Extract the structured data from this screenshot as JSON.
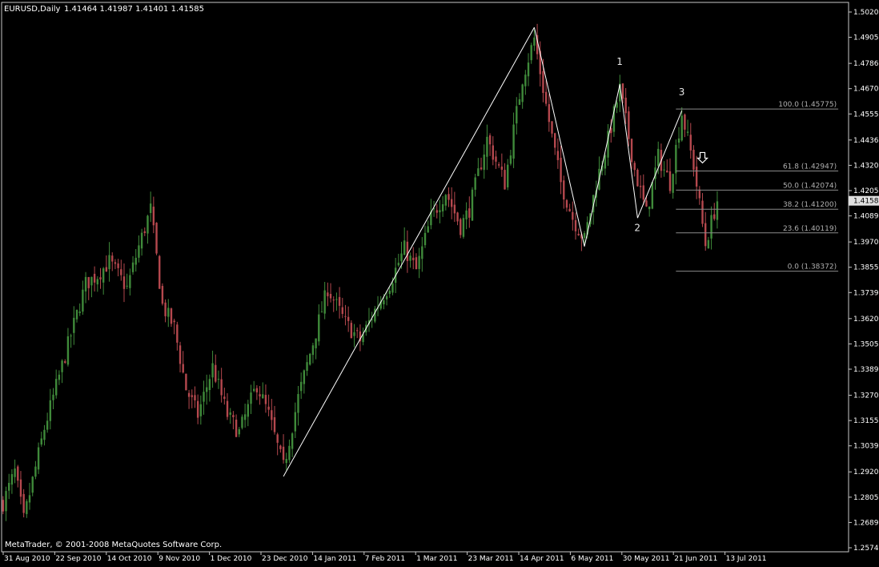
{
  "header": {
    "symbol_timeframe": "EURUSD,Daily",
    "ohlc": "1.41464 1.41987 1.41401 1.41585"
  },
  "footer": {
    "copyright": "MetaTrader, © 2001-2008 MetaQuotes Software Corp."
  },
  "colors": {
    "background": "#000000",
    "bull": "#3f8a3a",
    "bear": "#b5484e",
    "frame": "#c8c8c8",
    "fib": "#8a8a8a",
    "zigzag": "#ffffff",
    "current_price_bg": "#e0e0e0"
  },
  "chart_data": {
    "type": "candlestick",
    "y_ticks": [
      "1.50205",
      "1.49050",
      "1.47860",
      "1.46705",
      "1.45550",
      "1.44360",
      "1.43205",
      "1.42050",
      "1.40895",
      "1.39705",
      "1.38550",
      "1.37395",
      "1.36205",
      "1.35050",
      "1.33895",
      "1.32705",
      "1.31550",
      "1.30395",
      "1.29205",
      "1.28050",
      "1.26895",
      "1.25740"
    ],
    "ylim": [
      1.2574,
      1.50205
    ],
    "x_ticks": [
      "31 Aug 2010",
      "22 Sep 2010",
      "14 Oct 2010",
      "9 Nov 2010",
      "1 Dec 2010",
      "23 Dec 2010",
      "14 Jan 2011",
      "7 Feb 2011",
      "1 Mar 2011",
      "23 Mar 2011",
      "14 Apr 2011",
      "6 May 2011",
      "30 May 2011",
      "21 Jun 2011",
      "13 Jul 2011"
    ],
    "current_price": "1.41585",
    "anchors": [
      {
        "bar": 0,
        "price": 1.278
      },
      {
        "bar": 4,
        "price": 1.292
      },
      {
        "bar": 7,
        "price": 1.27
      },
      {
        "bar": 14,
        "price": 1.312
      },
      {
        "bar": 22,
        "price": 1.35
      },
      {
        "bar": 28,
        "price": 1.378
      },
      {
        "bar": 32,
        "price": 1.382
      },
      {
        "bar": 36,
        "price": 1.388
      },
      {
        "bar": 42,
        "price": 1.376
      },
      {
        "bar": 46,
        "price": 1.395
      },
      {
        "bar": 50,
        "price": 1.412
      },
      {
        "bar": 54,
        "price": 1.368
      },
      {
        "bar": 58,
        "price": 1.358
      },
      {
        "bar": 62,
        "price": 1.33
      },
      {
        "bar": 66,
        "price": 1.318
      },
      {
        "bar": 71,
        "price": 1.34
      },
      {
        "bar": 76,
        "price": 1.318
      },
      {
        "bar": 80,
        "price": 1.31
      },
      {
        "bar": 86,
        "price": 1.332
      },
      {
        "bar": 90,
        "price": 1.318
      },
      {
        "bar": 95,
        "price": 1.294
      },
      {
        "bar": 100,
        "price": 1.326
      },
      {
        "bar": 104,
        "price": 1.346
      },
      {
        "bar": 110,
        "price": 1.376
      },
      {
        "bar": 116,
        "price": 1.36
      },
      {
        "bar": 121,
        "price": 1.352
      },
      {
        "bar": 126,
        "price": 1.366
      },
      {
        "bar": 131,
        "price": 1.378
      },
      {
        "bar": 136,
        "price": 1.394
      },
      {
        "bar": 140,
        "price": 1.384
      },
      {
        "bar": 145,
        "price": 1.408
      },
      {
        "bar": 150,
        "price": 1.42
      },
      {
        "bar": 155,
        "price": 1.404
      },
      {
        "bar": 158,
        "price": 1.412
      },
      {
        "bar": 164,
        "price": 1.444
      },
      {
        "bar": 170,
        "price": 1.424
      },
      {
        "bar": 176,
        "price": 1.472
      },
      {
        "bar": 180,
        "price": 1.49
      },
      {
        "bar": 185,
        "price": 1.452
      },
      {
        "bar": 189,
        "price": 1.424
      },
      {
        "bar": 193,
        "price": 1.408
      },
      {
        "bar": 197,
        "price": 1.398
      },
      {
        "bar": 201,
        "price": 1.424
      },
      {
        "bar": 205,
        "price": 1.444
      },
      {
        "bar": 209,
        "price": 1.467
      },
      {
        "bar": 214,
        "price": 1.43
      },
      {
        "bar": 218,
        "price": 1.41
      },
      {
        "bar": 222,
        "price": 1.436
      },
      {
        "bar": 226,
        "price": 1.424
      },
      {
        "bar": 230,
        "price": 1.456
      },
      {
        "bar": 234,
        "price": 1.432
      },
      {
        "bar": 238,
        "price": 1.396
      },
      {
        "bar": 242,
        "price": 1.416
      }
    ],
    "zigzag": [
      {
        "bar": 95,
        "price": 1.29
      },
      {
        "bar": 180,
        "price": 1.495
      },
      {
        "bar": 197,
        "price": 1.395
      },
      {
        "bar": 209,
        "price": 1.469
      },
      {
        "bar": 215,
        "price": 1.408
      },
      {
        "bar": 230,
        "price": 1.457
      }
    ],
    "wave_labels": [
      {
        "text": "1",
        "bar": 209,
        "price": 1.478
      },
      {
        "text": "2",
        "bar": 215,
        "price": 1.402
      },
      {
        "text": "3",
        "bar": 230,
        "price": 1.464
      }
    ],
    "fibonacci": {
      "start_bar": 228,
      "end_bar": 283,
      "levels": [
        {
          "label": "100.0 (1.45775)",
          "price": 1.45775
        },
        {
          "label": "61.8 (1.42947)",
          "price": 1.42947
        },
        {
          "label": "50.0 (1.42074)",
          "price": 1.42074
        },
        {
          "label": "38.2 (1.41200)",
          "price": 1.412
        },
        {
          "label": "23.6 (1.40119)",
          "price": 1.40119
        },
        {
          "label": "0.0 (1.38372)",
          "price": 1.38372
        }
      ]
    },
    "arrow": {
      "bar": 237,
      "price": 1.4335
    }
  }
}
